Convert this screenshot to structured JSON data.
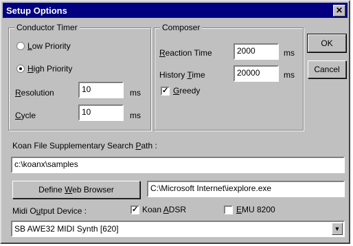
{
  "window": {
    "title": "Setup Options",
    "close_glyph": "✕"
  },
  "conductor": {
    "legend": "Conductor Timer",
    "low_priority": {
      "first": "L",
      "rest": "ow Priority",
      "selected": false
    },
    "high_priority": {
      "first": "H",
      "rest": "igh Priority",
      "selected": true
    },
    "resolution": {
      "label_first": "R",
      "label_rest": "esolution",
      "value": "10",
      "unit": "ms"
    },
    "cycle": {
      "label_first": "C",
      "label_rest": "ycle",
      "value": "10",
      "unit": "ms"
    }
  },
  "composer": {
    "legend": "Composer",
    "reaction": {
      "label_first": "R",
      "label_rest": "eaction Time",
      "value": "2000",
      "unit": "ms"
    },
    "history": {
      "label_pre": "History ",
      "label_u": "T",
      "label_rest": "ime",
      "value": "20000",
      "unit": "ms"
    },
    "greedy": {
      "first": "G",
      "rest": "reedy",
      "checked": true
    }
  },
  "buttons": {
    "ok": "OK",
    "cancel": "Cancel",
    "define_pre": "Define ",
    "define_u": "W",
    "define_rest": "eb Browser"
  },
  "search_path": {
    "label_pre": "Koan File Supplementary Search ",
    "label_u": "P",
    "label_rest": "ath :",
    "value": "c:\\koanx\\samples"
  },
  "browser_path": "C:\\Microsoft Internet\\iexplore.exe",
  "midi": {
    "label_pre": "Midi O",
    "label_u": "u",
    "label_rest": "tput Device :",
    "koan_adsr": {
      "pre": "Koan ",
      "u": "A",
      "rest": "DSR",
      "checked": true
    },
    "emu": {
      "u": "E",
      "rest": "MU 8200",
      "checked": false
    },
    "device": "SB AWE32 MIDI Synth [620]"
  }
}
